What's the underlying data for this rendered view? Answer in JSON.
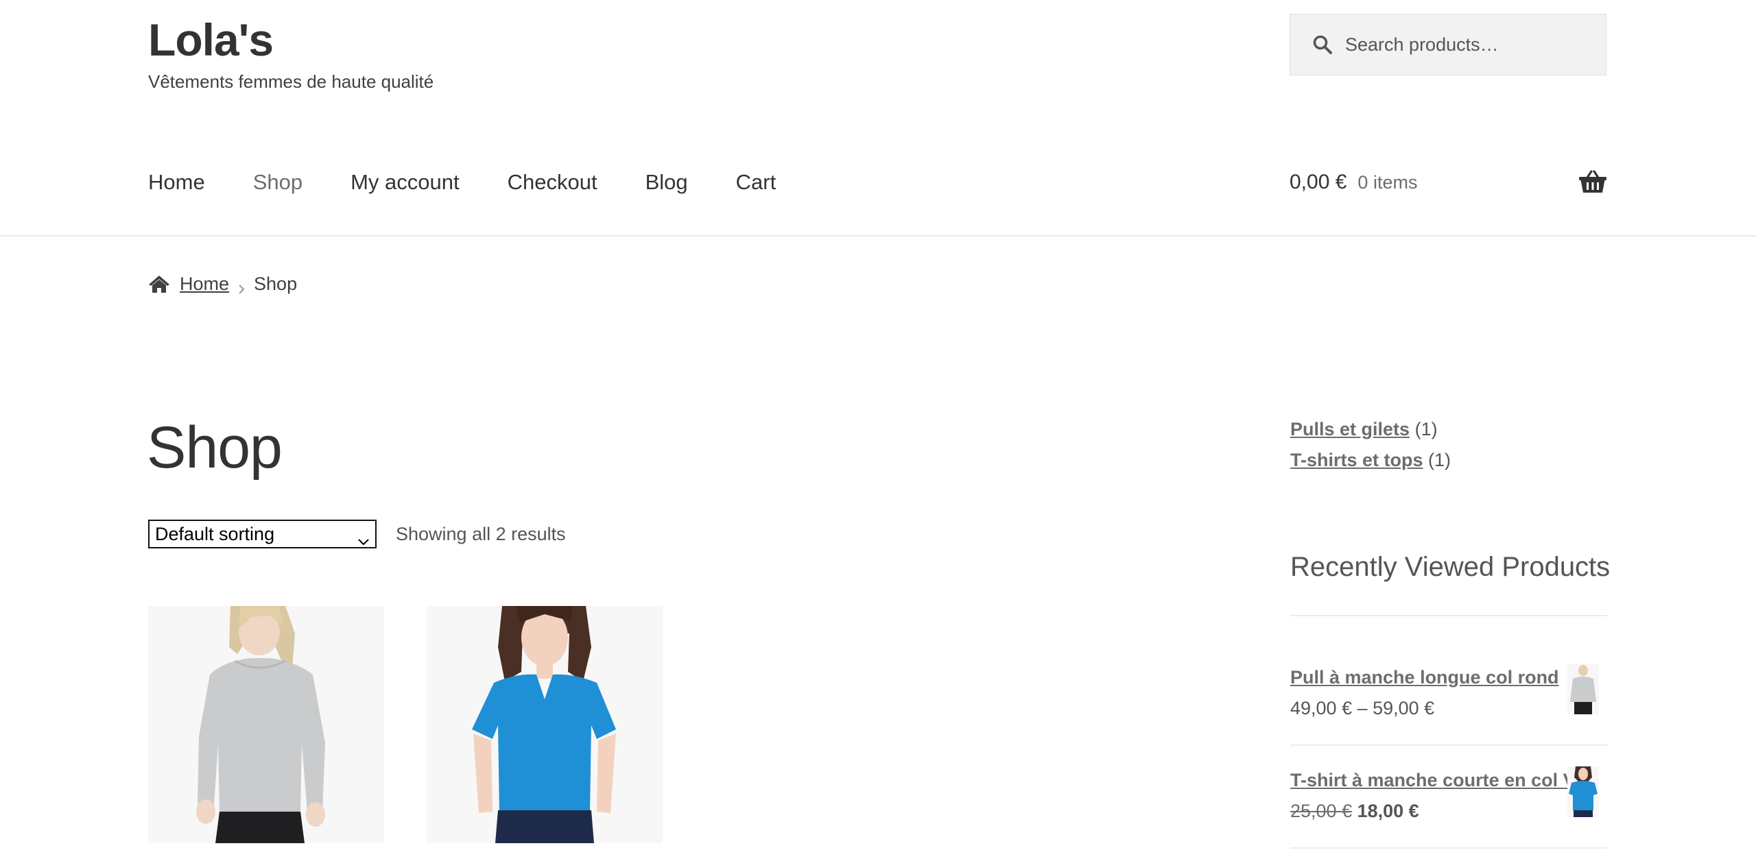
{
  "site": {
    "title": "Lola's",
    "tagline": "Vêtements femmes de haute qualité"
  },
  "search": {
    "placeholder": "Search products…"
  },
  "nav": {
    "items": [
      {
        "label": "Home",
        "current": false
      },
      {
        "label": "Shop",
        "current": true
      },
      {
        "label": "My account",
        "current": false
      },
      {
        "label": "Checkout",
        "current": false
      },
      {
        "label": "Blog",
        "current": false
      },
      {
        "label": "Cart",
        "current": false
      }
    ]
  },
  "cart": {
    "amount": "0,00 €",
    "count": "0 items",
    "icon": "basket-icon"
  },
  "breadcrumb": {
    "home_label": "Home",
    "current_label": "Shop"
  },
  "main": {
    "title": "Shop",
    "sort_value": "Default sorting",
    "result_count": "Showing all 2 results",
    "products": [
      {
        "image": "grey-sweater-photo"
      },
      {
        "image": "blue-tshirt-photo"
      }
    ]
  },
  "sidebar": {
    "categories": [
      {
        "label": "Pulls et gilets",
        "count": "(1)"
      },
      {
        "label": "T-shirts et tops",
        "count": "(1)"
      }
    ],
    "recently_viewed_title": "Recently Viewed Products",
    "recently_viewed": [
      {
        "name": "Pull à manche longue col rond",
        "price": "49,00 € – 59,00 €",
        "old_price": "",
        "new_price": ""
      },
      {
        "name": "T-shirt à manche courte en col V",
        "price": "",
        "old_price": "25,00 €",
        "new_price": "18,00 €"
      }
    ]
  },
  "colors": {
    "text": "#333333",
    "muted": "#6d6d6d",
    "search_bg": "#f2f2f2",
    "tshirt_blue": "#1f8fd6",
    "sweater_grey": "#c9cbcd"
  }
}
